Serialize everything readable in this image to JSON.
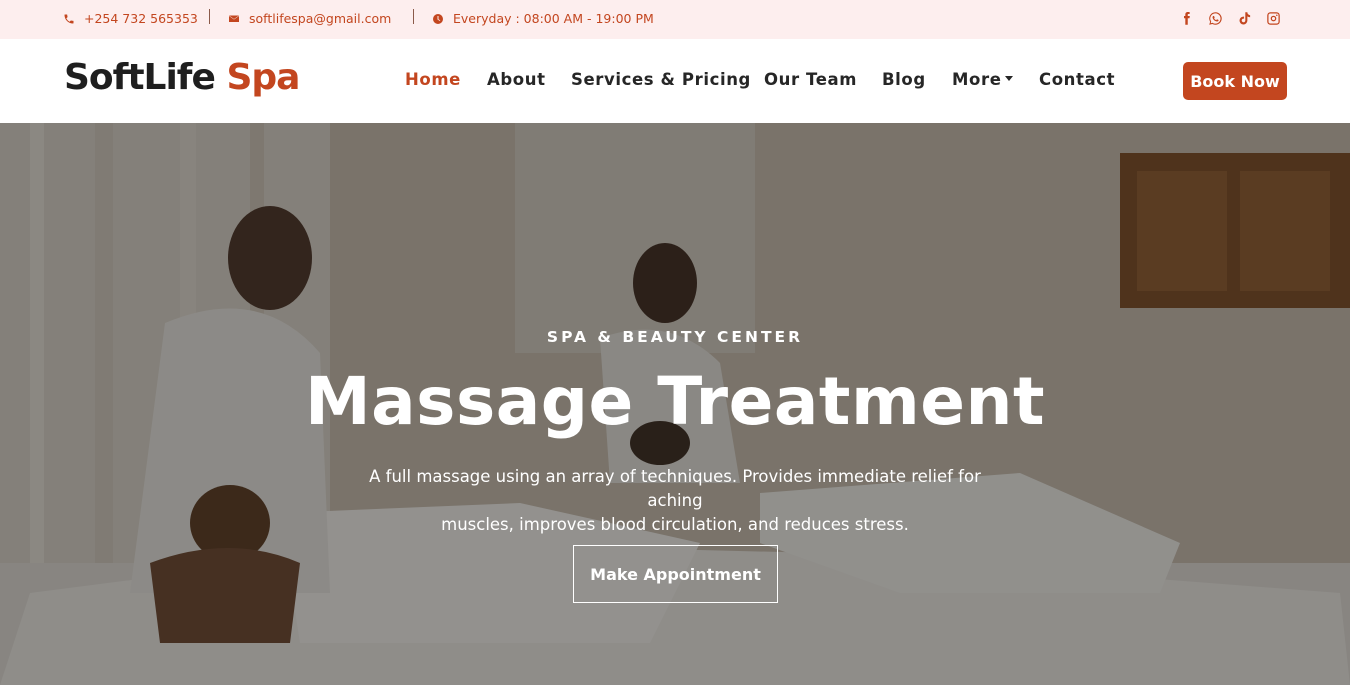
{
  "topbar": {
    "phone": "+254 732 565353",
    "email": "softlifespa@gmail.com",
    "hours": "Everyday : 08:00 AM - 19:00 PM",
    "socials": [
      "facebook-icon",
      "whatsapp-icon",
      "tiktok-icon",
      "instagram-icon"
    ]
  },
  "header": {
    "logo_part1": "SoftLife",
    "logo_part2": "Spa",
    "nav": [
      "Home",
      "About",
      "Services & Pricing",
      "Our Team",
      "Blog",
      "More",
      "Contact"
    ],
    "active_nav": "Home",
    "book_label": "Book Now"
  },
  "hero": {
    "kicker": "SPA & BEAUTY CENTER",
    "title": "Massage Treatment",
    "description_line1": "A full massage using an array of techniques. Provides immediate relief for aching",
    "description_line2": "muscles, improves blood circulation, and reduces stress.",
    "cta_label": "Make Appointment"
  },
  "colors": {
    "accent": "#c3461f",
    "topbar_bg": "#fdeeee",
    "text_dark": "#262626"
  }
}
